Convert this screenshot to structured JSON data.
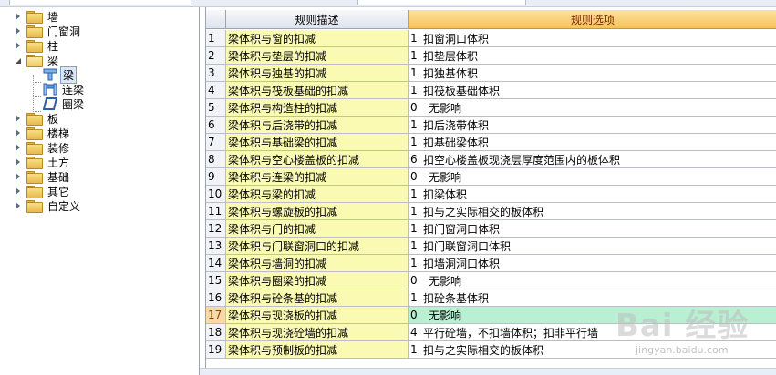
{
  "tree": {
    "nodes": [
      {
        "label": "墙",
        "expanded": false
      },
      {
        "label": "门窗洞",
        "expanded": false
      },
      {
        "label": "柱",
        "expanded": false
      },
      {
        "label": "梁",
        "expanded": true,
        "children": [
          {
            "label": "梁",
            "icon": "beam-icon",
            "selected": true
          },
          {
            "label": "连梁",
            "icon": "coupling-beam-icon"
          },
          {
            "label": "圈梁",
            "icon": "ring-beam-icon"
          }
        ]
      },
      {
        "label": "板",
        "expanded": false
      },
      {
        "label": "楼梯",
        "expanded": false
      },
      {
        "label": "装修",
        "expanded": false
      },
      {
        "label": "土方",
        "expanded": false
      },
      {
        "label": "基础",
        "expanded": false
      },
      {
        "label": "其它",
        "expanded": false
      },
      {
        "label": "自定义",
        "expanded": false
      }
    ]
  },
  "grid": {
    "headers": {
      "desc": "规则描述",
      "option": "规则选项"
    },
    "rows": [
      {
        "num": "1",
        "desc": "梁体积与窗的扣减",
        "code": "1",
        "option": "扣窗洞口体积"
      },
      {
        "num": "2",
        "desc": "梁体积与垫层的扣减",
        "code": "1",
        "option": "扣垫层体积"
      },
      {
        "num": "3",
        "desc": "梁体积与独基的扣减",
        "code": "1",
        "option": "扣独基体积"
      },
      {
        "num": "4",
        "desc": "梁体积与筏板基础的扣减",
        "code": "1",
        "option": "扣筏板基础体积"
      },
      {
        "num": "5",
        "desc": "梁体积与构造柱的扣减",
        "code": "0",
        "option": "无影响"
      },
      {
        "num": "6",
        "desc": "梁体积与后浇带的扣减",
        "code": "1",
        "option": "扣后浇带体积"
      },
      {
        "num": "7",
        "desc": "梁体积与基础梁的扣减",
        "code": "1",
        "option": "扣基础梁体积"
      },
      {
        "num": "8",
        "desc": "梁体积与空心楼盖板的扣减",
        "code": "6",
        "option": "扣空心楼盖板现浇层厚度范围内的板体积"
      },
      {
        "num": "9",
        "desc": "梁体积与连梁的扣减",
        "code": "0",
        "option": "无影响"
      },
      {
        "num": "10",
        "desc": "梁体积与梁的扣减",
        "code": "1",
        "option": "扣梁体积"
      },
      {
        "num": "11",
        "desc": "梁体积与螺旋板的扣减",
        "code": "1",
        "option": "扣与之实际相交的板体积"
      },
      {
        "num": "12",
        "desc": "梁体积与门的扣减",
        "code": "1",
        "option": "扣门窗洞口体积"
      },
      {
        "num": "13",
        "desc": "梁体积与门联窗洞口的扣减",
        "code": "1",
        "option": "扣门联窗洞口体积"
      },
      {
        "num": "14",
        "desc": "梁体积与墙洞的扣减",
        "code": "1",
        "option": "扣墙洞洞口体积"
      },
      {
        "num": "15",
        "desc": "梁体积与圈梁的扣减",
        "code": "0",
        "option": "无影响"
      },
      {
        "num": "16",
        "desc": "梁体积与砼条基的扣减",
        "code": "1",
        "option": "扣砼条基体积"
      },
      {
        "num": "17",
        "desc": "梁体积与现浇板的扣减",
        "code": "0",
        "option": "无影响",
        "active": true
      },
      {
        "num": "18",
        "desc": "梁体积与现浇砼墙的扣减",
        "code": "4",
        "option": "平行砼墙，不扣墙体积；扣非平行墙"
      },
      {
        "num": "19",
        "desc": "梁体积与预制板的扣减",
        "code": "1",
        "option": "扣与之实际相交的板体积"
      }
    ]
  },
  "watermark": {
    "brand": "Bai 经验",
    "url": "jingyan.baidu.com"
  }
}
